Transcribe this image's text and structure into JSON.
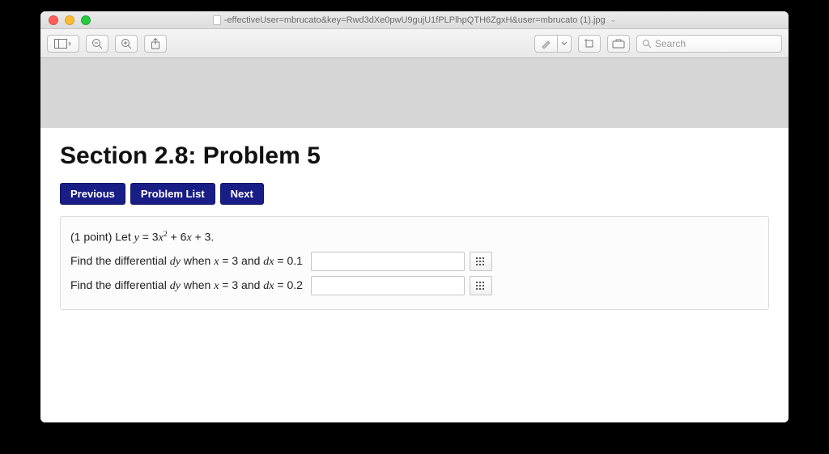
{
  "window": {
    "title": "-effectiveUser=mbrucato&key=Rwd3dXe0pwU9gujU1fPLPlhpQTH6ZgxH&user=mbrucato (1).jpg"
  },
  "toolbar": {
    "search_placeholder": "Search"
  },
  "page": {
    "heading": "Section 2.8: Problem 5",
    "nav": {
      "prev": "Previous",
      "list": "Problem List",
      "next": "Next"
    },
    "problem": {
      "points_prefix": "(1 point) Let ",
      "equation_y": "y",
      "equation_eq": " = ",
      "equation_rhs_a": "3",
      "equation_rhs_var": "x",
      "equation_rhs_exp": "2",
      "equation_rhs_plus1": " + 6",
      "equation_rhs_var2": "x",
      "equation_rhs_plus2": " + 3.",
      "line1_prefix": "Find the differential ",
      "line1_dy": "dy",
      "line1_mid": " when ",
      "line1_x": "x",
      "line1_eq1": " = 3 and ",
      "line1_dx": "dx",
      "line1_eq2": " = 0.1",
      "line2_prefix": "Find the differential ",
      "line2_dy": "dy",
      "line2_mid": " when ",
      "line2_x": "x",
      "line2_eq1": " = 3 and ",
      "line2_dx": "dx",
      "line2_eq2": " = 0.2"
    }
  }
}
